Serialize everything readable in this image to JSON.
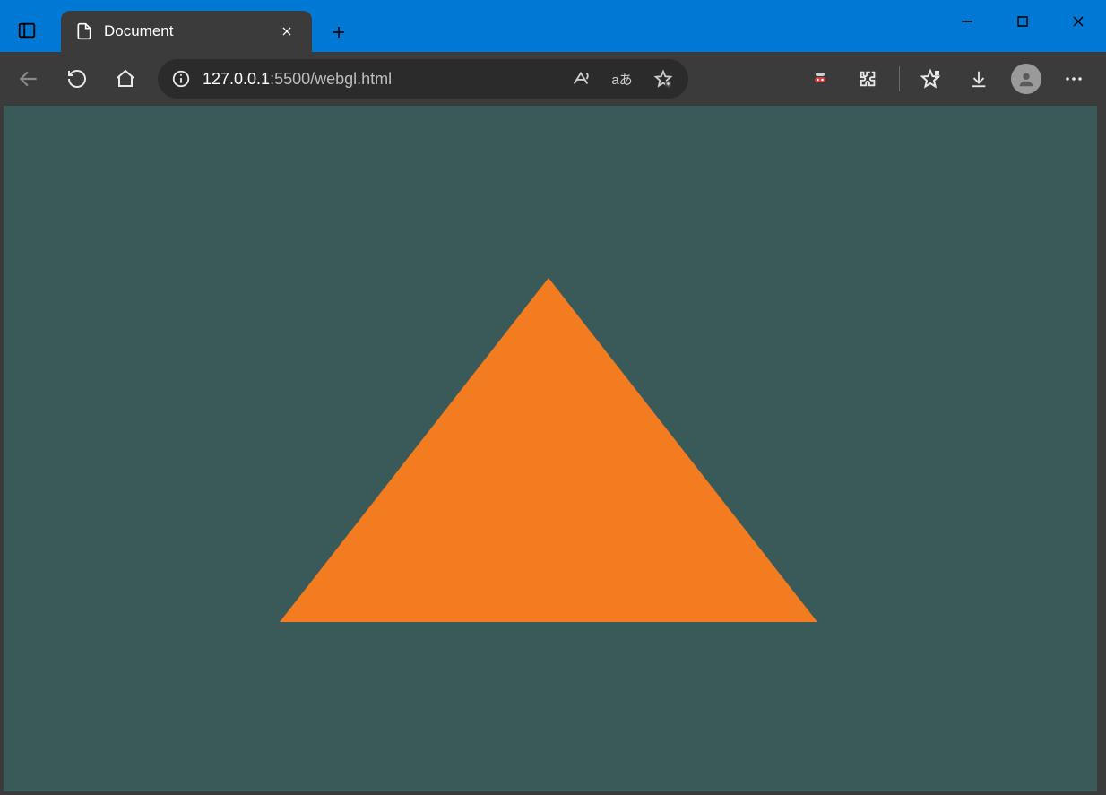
{
  "window": {
    "title": "Document"
  },
  "tab": {
    "title": "Document"
  },
  "address": {
    "host": "127.0.0.1",
    "rest": ":5500/webgl.html"
  },
  "translate_label": "aあ",
  "page": {
    "background_color": "#3a5a5a",
    "triangle_color": "#f47c20"
  }
}
